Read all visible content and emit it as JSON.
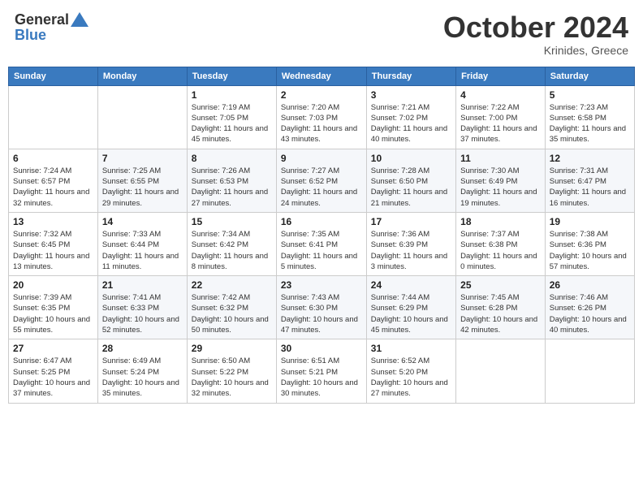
{
  "header": {
    "logo_general": "General",
    "logo_blue": "Blue",
    "month": "October 2024",
    "location": "Krinides, Greece"
  },
  "weekdays": [
    "Sunday",
    "Monday",
    "Tuesday",
    "Wednesday",
    "Thursday",
    "Friday",
    "Saturday"
  ],
  "weeks": [
    [
      null,
      null,
      {
        "day": 1,
        "sunrise": "7:19 AM",
        "sunset": "7:05 PM",
        "daylight": "11 hours and 45 minutes."
      },
      {
        "day": 2,
        "sunrise": "7:20 AM",
        "sunset": "7:03 PM",
        "daylight": "11 hours and 43 minutes."
      },
      {
        "day": 3,
        "sunrise": "7:21 AM",
        "sunset": "7:02 PM",
        "daylight": "11 hours and 40 minutes."
      },
      {
        "day": 4,
        "sunrise": "7:22 AM",
        "sunset": "7:00 PM",
        "daylight": "11 hours and 37 minutes."
      },
      {
        "day": 5,
        "sunrise": "7:23 AM",
        "sunset": "6:58 PM",
        "daylight": "11 hours and 35 minutes."
      }
    ],
    [
      {
        "day": 6,
        "sunrise": "7:24 AM",
        "sunset": "6:57 PM",
        "daylight": "11 hours and 32 minutes."
      },
      {
        "day": 7,
        "sunrise": "7:25 AM",
        "sunset": "6:55 PM",
        "daylight": "11 hours and 29 minutes."
      },
      {
        "day": 8,
        "sunrise": "7:26 AM",
        "sunset": "6:53 PM",
        "daylight": "11 hours and 27 minutes."
      },
      {
        "day": 9,
        "sunrise": "7:27 AM",
        "sunset": "6:52 PM",
        "daylight": "11 hours and 24 minutes."
      },
      {
        "day": 10,
        "sunrise": "7:28 AM",
        "sunset": "6:50 PM",
        "daylight": "11 hours and 21 minutes."
      },
      {
        "day": 11,
        "sunrise": "7:30 AM",
        "sunset": "6:49 PM",
        "daylight": "11 hours and 19 minutes."
      },
      {
        "day": 12,
        "sunrise": "7:31 AM",
        "sunset": "6:47 PM",
        "daylight": "11 hours and 16 minutes."
      }
    ],
    [
      {
        "day": 13,
        "sunrise": "7:32 AM",
        "sunset": "6:45 PM",
        "daylight": "11 hours and 13 minutes."
      },
      {
        "day": 14,
        "sunrise": "7:33 AM",
        "sunset": "6:44 PM",
        "daylight": "11 hours and 11 minutes."
      },
      {
        "day": 15,
        "sunrise": "7:34 AM",
        "sunset": "6:42 PM",
        "daylight": "11 hours and 8 minutes."
      },
      {
        "day": 16,
        "sunrise": "7:35 AM",
        "sunset": "6:41 PM",
        "daylight": "11 hours and 5 minutes."
      },
      {
        "day": 17,
        "sunrise": "7:36 AM",
        "sunset": "6:39 PM",
        "daylight": "11 hours and 3 minutes."
      },
      {
        "day": 18,
        "sunrise": "7:37 AM",
        "sunset": "6:38 PM",
        "daylight": "11 hours and 0 minutes."
      },
      {
        "day": 19,
        "sunrise": "7:38 AM",
        "sunset": "6:36 PM",
        "daylight": "10 hours and 57 minutes."
      }
    ],
    [
      {
        "day": 20,
        "sunrise": "7:39 AM",
        "sunset": "6:35 PM",
        "daylight": "10 hours and 55 minutes."
      },
      {
        "day": 21,
        "sunrise": "7:41 AM",
        "sunset": "6:33 PM",
        "daylight": "10 hours and 52 minutes."
      },
      {
        "day": 22,
        "sunrise": "7:42 AM",
        "sunset": "6:32 PM",
        "daylight": "10 hours and 50 minutes."
      },
      {
        "day": 23,
        "sunrise": "7:43 AM",
        "sunset": "6:30 PM",
        "daylight": "10 hours and 47 minutes."
      },
      {
        "day": 24,
        "sunrise": "7:44 AM",
        "sunset": "6:29 PM",
        "daylight": "10 hours and 45 minutes."
      },
      {
        "day": 25,
        "sunrise": "7:45 AM",
        "sunset": "6:28 PM",
        "daylight": "10 hours and 42 minutes."
      },
      {
        "day": 26,
        "sunrise": "7:46 AM",
        "sunset": "6:26 PM",
        "daylight": "10 hours and 40 minutes."
      }
    ],
    [
      {
        "day": 27,
        "sunrise": "6:47 AM",
        "sunset": "5:25 PM",
        "daylight": "10 hours and 37 minutes."
      },
      {
        "day": 28,
        "sunrise": "6:49 AM",
        "sunset": "5:24 PM",
        "daylight": "10 hours and 35 minutes."
      },
      {
        "day": 29,
        "sunrise": "6:50 AM",
        "sunset": "5:22 PM",
        "daylight": "10 hours and 32 minutes."
      },
      {
        "day": 30,
        "sunrise": "6:51 AM",
        "sunset": "5:21 PM",
        "daylight": "10 hours and 30 minutes."
      },
      {
        "day": 31,
        "sunrise": "6:52 AM",
        "sunset": "5:20 PM",
        "daylight": "10 hours and 27 minutes."
      },
      null,
      null
    ]
  ]
}
